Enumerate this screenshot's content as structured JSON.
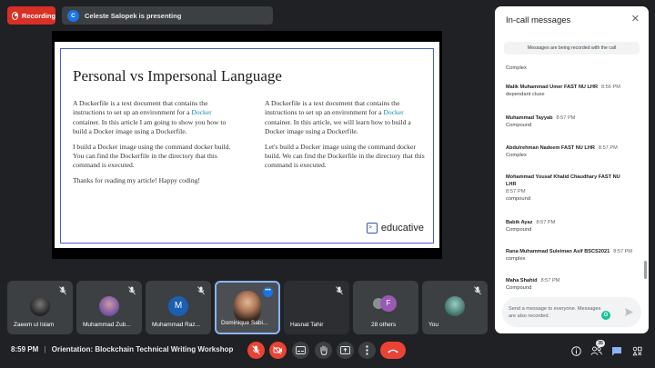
{
  "top_bar": {
    "recording_label": "Recording",
    "presenter_initial": "C",
    "presenter_text": "Celeste Salopek is presenting"
  },
  "slide": {
    "title": "Personal vs Impersonal Language",
    "left_column": {
      "p1_before": "A Dockerfile is a text document that contains the instructions to set up an environment for a",
      "p1_link": "Docker",
      "p1_after": "container. In this article I am going to show you how to build a Docker image using a Dockerfile.",
      "p2": "I build a Docker image using the command docker build. You can find the Dockerfile in the directory that this command is executed.",
      "p3": "Thanks for reading my article! Happy coding!"
    },
    "right_column": {
      "p1_before": "A Dockerfile is a text document that contains the instructions to set up an environment for a",
      "p1_link": "Docker",
      "p1_after": "container. In this article, we will learn how to build a Docker image using a Dockerfile.",
      "p2": "Let's build a Docker image using the command docker build. We can find the Dockerfile in the directory that this command is executed."
    },
    "logo_text": "educative"
  },
  "tiles": [
    {
      "name": "Zaeem ul Islam"
    },
    {
      "name": "Muhammad Zub..."
    },
    {
      "name": "Muhammad Raz...",
      "initial": "M"
    },
    {
      "name": "Dominique Sabi..."
    },
    {
      "name": "Hasnat Tahir"
    },
    {
      "name": "28 others",
      "initial": "F"
    },
    {
      "name": "You"
    }
  ],
  "bottom_bar": {
    "time": "8:59 PM",
    "separator": "|",
    "meeting_title": "Orientation: Blockchain Technical Writing Workshop",
    "participant_count": "35"
  },
  "chat": {
    "title": "In-call messages",
    "recording_notice": "Messages are being recorded with the call",
    "messages": [
      {
        "sender": "",
        "time": "",
        "text": "Complex"
      },
      {
        "sender": "Malik Muhammad Umer FAST NU LHR",
        "time": "8:56 PM",
        "text": "dependant cluse"
      },
      {
        "sender": "Muhammad Tayyab",
        "time": "8:57 PM",
        "text": "Compound"
      },
      {
        "sender": "Abdulrehman Nadeem FAST NU LHR",
        "time": "8:57 PM",
        "text": "Complex"
      },
      {
        "sender": "Mohammad Yousaf Khalid Chaudhary FAST NU LHR",
        "time": "8:57 PM",
        "text": "compound"
      },
      {
        "sender": "Babik Ayaz",
        "time": "8:57 PM",
        "text": "Compound"
      },
      {
        "sender": "Rana Muhammad Suleiman Asif BSCS2021",
        "time": "8:57 PM",
        "text": "complex"
      },
      {
        "sender": "Maha Shahid",
        "time": "8:57 PM",
        "text": "Compound"
      }
    ],
    "compose_placeholder": "Send a message to everyone. Messages are also recorded."
  }
}
